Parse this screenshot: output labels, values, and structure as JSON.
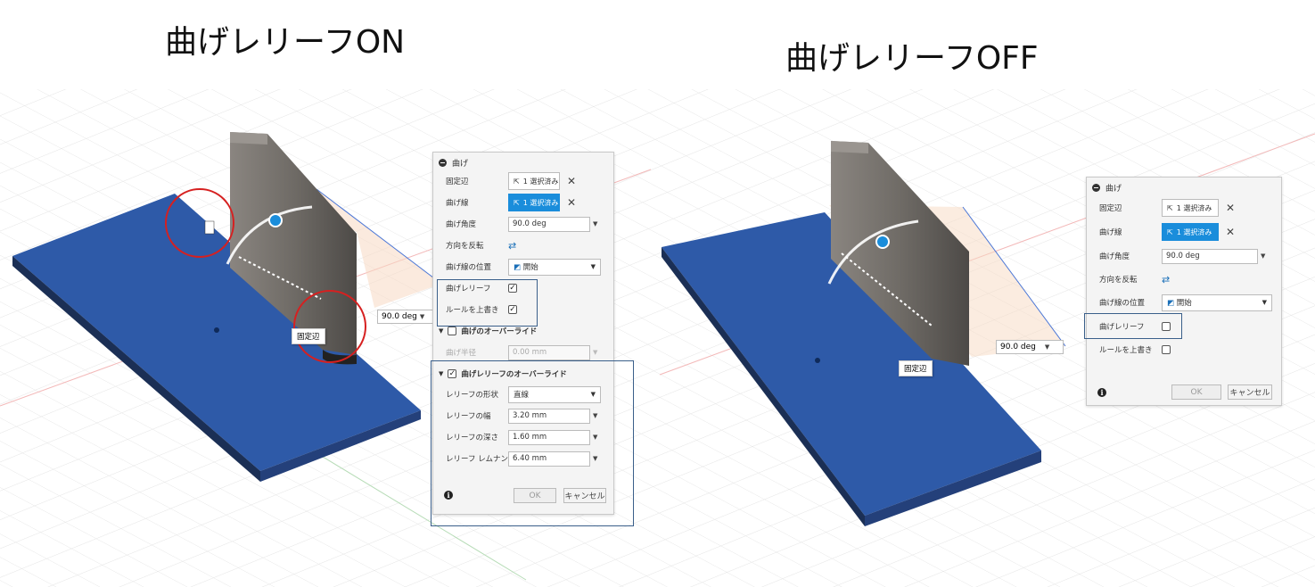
{
  "headings": {
    "left": "曲げレリーフON",
    "right": "曲げレリーフOFF"
  },
  "left_viewport": {
    "angle_value": "90.0 deg",
    "fixed_edge_tag": "固定辺"
  },
  "right_viewport": {
    "angle_value": "90.0 deg",
    "fixed_edge_tag": "固定辺"
  },
  "left_panel": {
    "title": "曲げ",
    "fixed_edge_label": "固定辺",
    "fixed_edge_value": "1 選択済み",
    "bend_line_label": "曲げ線",
    "bend_line_value": "1 選択済み",
    "bend_angle_label": "曲げ角度",
    "bend_angle_value": "90.0 deg",
    "flip_label": "方向を反転",
    "position_label": "曲げ線の位置",
    "position_value": "開始",
    "relief_label": "曲げレリーフ",
    "relief_checked": true,
    "override_rule_label": "ルールを上書き",
    "override_rule_checked": true,
    "bend_override_label": "曲げのオーバーライド",
    "bend_radius_label": "曲げ半径",
    "bend_radius_value": "0.00 mm",
    "relief_override_label": "曲げレリーフのオーバーライド",
    "relief_shape_label": "レリーフの形状",
    "relief_shape_value": "直線",
    "relief_width_label": "レリーフの幅",
    "relief_width_value": "3.20 mm",
    "relief_depth_label": "レリーフの深さ",
    "relief_depth_value": "1.60 mm",
    "relief_remnant_label": "レリーフ レムナント",
    "relief_remnant_value": "6.40 mm",
    "ok_label": "OK",
    "cancel_label": "キャンセル"
  },
  "right_panel": {
    "title": "曲げ",
    "fixed_edge_label": "固定辺",
    "fixed_edge_value": "1 選択済み",
    "bend_line_label": "曲げ線",
    "bend_line_value": "1 選択済み",
    "bend_angle_label": "曲げ角度",
    "bend_angle_value": "90.0 deg",
    "flip_label": "方向を反転",
    "position_label": "曲げ線の位置",
    "position_value": "開始",
    "relief_label": "曲げレリーフ",
    "relief_checked": false,
    "override_rule_label": "ルールを上書き",
    "override_rule_checked": false,
    "ok_label": "OK",
    "cancel_label": "キャンセル"
  },
  "colors": {
    "accent": "#1a8ddb",
    "sheet": "#2e5aa8",
    "wall": "#6e6a66",
    "highlight": "#3a5f8a",
    "circle": "#d62020"
  }
}
